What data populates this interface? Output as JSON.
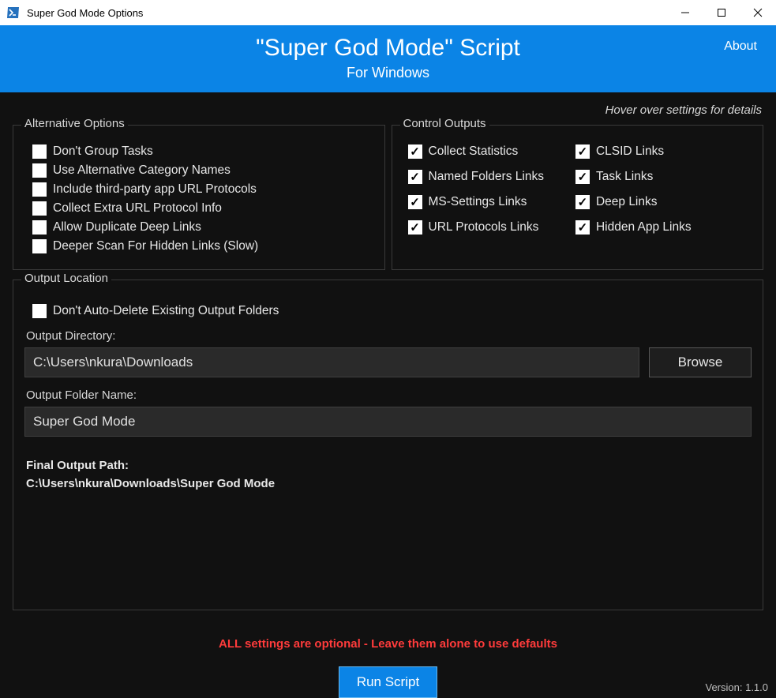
{
  "window": {
    "title": "Super God Mode Options"
  },
  "banner": {
    "title": "\"Super God Mode\" Script",
    "subtitle": "For Windows",
    "about": "About"
  },
  "hint": "Hover over settings for details",
  "groups": {
    "alt": {
      "legend": "Alternative Options",
      "items": [
        {
          "label": "Don't Group Tasks",
          "checked": false
        },
        {
          "label": "Use Alternative Category Names",
          "checked": false
        },
        {
          "label": "Include third-party app URL Protocols",
          "checked": false
        },
        {
          "label": "Collect Extra URL Protocol Info",
          "checked": false
        },
        {
          "label": "Allow Duplicate Deep Links",
          "checked": false
        },
        {
          "label": "Deeper Scan For Hidden Links (Slow)",
          "checked": false
        }
      ]
    },
    "ctrl": {
      "legend": "Control Outputs",
      "col1": [
        {
          "label": "Collect Statistics",
          "checked": true
        },
        {
          "label": "Named Folders Links",
          "checked": true
        },
        {
          "label": "MS-Settings Links",
          "checked": true
        },
        {
          "label": "URL Protocols Links",
          "checked": true
        }
      ],
      "col2": [
        {
          "label": "CLSID Links",
          "checked": true
        },
        {
          "label": "Task Links",
          "checked": true
        },
        {
          "label": "Deep Links",
          "checked": true
        },
        {
          "label": "Hidden App Links",
          "checked": true
        }
      ]
    },
    "out": {
      "legend": "Output Location",
      "noDelete": {
        "label": "Don't Auto-Delete Existing Output Folders",
        "checked": false
      },
      "dirLabel": "Output Directory:",
      "dirValue": "C:\\Users\\nkura\\Downloads",
      "browse": "Browse",
      "folderLabel": "Output Folder Name:",
      "folderValue": "Super God Mode",
      "finalLabel": "Final Output Path:",
      "finalValue": "C:\\Users\\nkura\\Downloads\\Super God Mode"
    }
  },
  "note": "ALL settings are optional - Leave them alone to use defaults",
  "runButton": "Run Script",
  "version": "Version: 1.1.0"
}
